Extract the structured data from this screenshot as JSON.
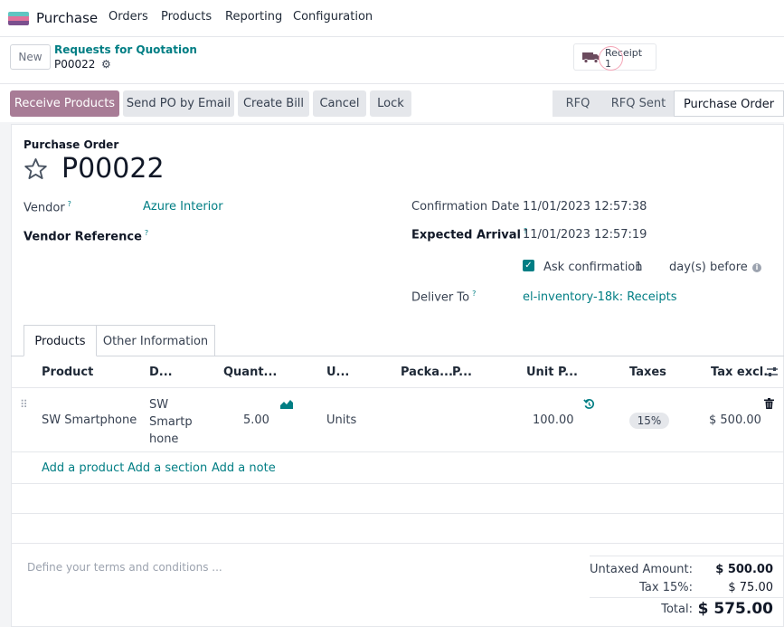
{
  "navbar": {
    "app_name": "Purchase",
    "menu": [
      "Orders",
      "Products",
      "Reporting",
      "Configuration"
    ]
  },
  "control_panel": {
    "new_label": "New",
    "breadcrumb_parent": "Requests for Quotation",
    "breadcrumb_current": "P00022",
    "smart_button_label": "Receipt",
    "smart_button_count": "1"
  },
  "actions": {
    "receive": "Receive Products",
    "send_email": "Send PO by Email",
    "create_bill": "Create Bill",
    "cancel": "Cancel",
    "lock": "Lock"
  },
  "status": {
    "stages": [
      "RFQ",
      "RFQ Sent",
      "Purchase Order"
    ],
    "active": "Purchase Order"
  },
  "form": {
    "doc_type": "Purchase Order",
    "name": "P00022",
    "vendor_label": "Vendor",
    "vendor_value": "Azure Interior",
    "vendor_ref_label": "Vendor Reference",
    "confirmation_date_label": "Confirmation Date",
    "confirmation_date_value": "11/01/2023 12:57:38",
    "expected_arrival_label": "Expected Arrival",
    "expected_arrival_value": "11/01/2023 12:57:19",
    "ask_confirmation_label": "Ask confirmation",
    "ask_confirmation_days": "1",
    "ask_confirmation_suffix": "day(s) before",
    "deliver_to_label": "Deliver To",
    "deliver_to_value": "el-inventory-18k: Receipts",
    "help_mark": "?"
  },
  "tabs": [
    "Products",
    "Other Information"
  ],
  "table": {
    "headers": [
      "Product",
      "D...",
      "Quant...",
      "U...",
      "Packa...",
      "P...",
      "Unit P...",
      "Taxes",
      "Tax excl."
    ],
    "row": {
      "product": "SW Smartphone",
      "description_lines": [
        "SW",
        "Smartp",
        "hone"
      ],
      "quantity": "5.00",
      "uom": "Units",
      "unit_price": "100.00",
      "tax": "15%",
      "subtotal": "$ 500.00"
    },
    "add_product": "Add a product",
    "add_section": "Add a section",
    "add_note": "Add a note"
  },
  "footer": {
    "terms_placeholder": "Define your terms and conditions ...",
    "untaxed_label": "Untaxed Amount:",
    "untaxed_value": "$ 500.00",
    "tax_label": "Tax 15%:",
    "tax_value": "$ 75.00",
    "total_label": "Total:",
    "total_value": "$ 575.00"
  },
  "colors": {
    "brand_teal": "#017e84",
    "primary_button": "#a87c96"
  }
}
